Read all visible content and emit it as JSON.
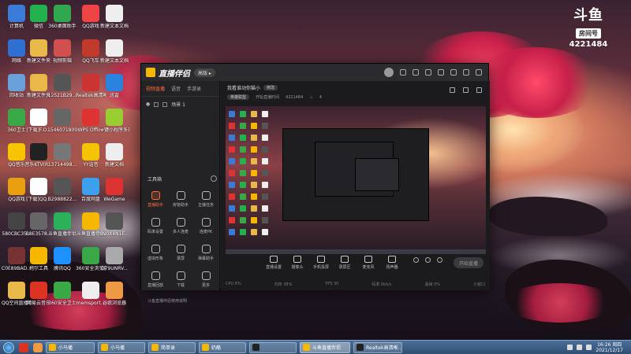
{
  "watermark": {
    "logo": "斗鱼",
    "sub": "房间号",
    "room_number": "4221484"
  },
  "desktop_icons": [
    {
      "label": "计算机",
      "icon": "computer-icon",
      "color": "#3b7bd8"
    },
    {
      "label": "微信",
      "icon": "wechat-icon",
      "color": "#22b14c"
    },
    {
      "label": "360桌面助手",
      "icon": "360-icon",
      "color": "#2fa84f"
    },
    {
      "label": "QQ游戏",
      "icon": "qq-game-icon",
      "color": "#e44"
    },
    {
      "label": "新建文本文档",
      "icon": "text-file-icon",
      "color": "#eee"
    },
    {
      "label": "网络",
      "icon": "network-icon",
      "color": "#2f6fd0"
    },
    {
      "label": "新建文件夹",
      "icon": "folder-icon",
      "color": "#e8b84a"
    },
    {
      "label": "视频剪辑",
      "icon": "video-icon",
      "color": "#d05050"
    },
    {
      "label": "QQ飞车",
      "icon": "qq-speed-icon",
      "color": "#c0392b"
    },
    {
      "label": "新建文本文档",
      "icon": "text-file-icon",
      "color": "#eee"
    },
    {
      "label": "回收站",
      "icon": "recycle-bin-icon",
      "color": "#6aa0d8"
    },
    {
      "label": "新建文件夹",
      "icon": "folder-icon",
      "color": "#e8b84a"
    },
    {
      "label": "12521B29...",
      "icon": "image-icon",
      "color": "#555"
    },
    {
      "label": "Realtek高清晰音频管理器",
      "icon": "realtek-icon",
      "color": "#c33"
    },
    {
      "label": "迅雷",
      "icon": "xunlei-icon",
      "color": "#2b83e0"
    },
    {
      "label": "360卫士",
      "icon": "360-safe-icon",
      "color": "#3aa847"
    },
    {
      "label": "[下载]F.O...",
      "icon": "doc-icon",
      "color": "#fff"
    },
    {
      "label": "1546071800",
      "icon": "image-icon",
      "color": "#666"
    },
    {
      "label": "WPS Office",
      "icon": "wps-icon",
      "color": "#d33"
    },
    {
      "label": "一键小程序多开管理",
      "icon": "tool-icon",
      "color": "#9acd32"
    },
    {
      "label": "QQ音乐",
      "icon": "qq-music-icon",
      "color": "#f6c500"
    },
    {
      "label": "音乐KTV(R...",
      "icon": "panda-icon",
      "color": "#222"
    },
    {
      "label": "13714498...",
      "icon": "image-icon",
      "color": "#777"
    },
    {
      "label": "YY语音",
      "icon": "yy-icon",
      "color": "#f5c400"
    },
    {
      "label": "新建文档",
      "icon": "text-file-icon",
      "color": "#eee"
    },
    {
      "label": "QQ游戏",
      "icon": "qq-game-icon",
      "color": "#e8a010"
    },
    {
      "label": "[下载]QQ...",
      "icon": "doc-icon",
      "color": "#fff"
    },
    {
      "label": "B2988822...",
      "icon": "image-icon",
      "color": "#555"
    },
    {
      "label": "百度网盘",
      "icon": "baidu-pan-icon",
      "color": "#3ca0ef"
    },
    {
      "label": "WeGame",
      "icon": "wegame-icon",
      "color": "#d33"
    },
    {
      "label": "580CBC35...",
      "icon": "image-icon",
      "color": "#444"
    },
    {
      "label": "B8E3578...",
      "icon": "image-icon",
      "color": "#666"
    },
    {
      "label": "斗鱼直播伴侣",
      "icon": "douyu-icon",
      "color": "#2bb15a"
    },
    {
      "label": "斗鱼直播伴侣",
      "icon": "douyu-icon",
      "color": "#f5b700"
    },
    {
      "label": "6N0X4N1E...",
      "icon": "image-icon",
      "color": "#555"
    },
    {
      "label": "C0E89BAD...",
      "icon": "image-icon",
      "color": "#733"
    },
    {
      "label": "柯尔工具",
      "icon": "tool-icon",
      "color": "#f5b700"
    },
    {
      "label": "腾讯QQ",
      "icon": "qq-icon",
      "color": "#1e90ff"
    },
    {
      "label": "360安全浏览器",
      "icon": "360-browser-icon",
      "color": "#3aa847"
    },
    {
      "label": "D79UNRV...",
      "icon": "image-icon",
      "color": "#aaa"
    },
    {
      "label": "QQ空间直播助手",
      "icon": "folder-icon",
      "color": "#e8b84a"
    },
    {
      "label": "网易云音乐",
      "icon": "netease-music-icon",
      "color": "#d32"
    },
    {
      "label": "360安全卫士",
      "icon": "360-safe-icon",
      "color": "#3aa847"
    },
    {
      "label": "memsport...",
      "icon": "folder-icon",
      "color": "#eee"
    },
    {
      "label": "谷歌浏览器",
      "icon": "chrome-icon",
      "color": "#e94"
    }
  ],
  "app": {
    "title": "直播伴侣",
    "badge": "高版 ▸",
    "left_tabs": [
      "视频直播",
      "语音",
      "手游录"
    ],
    "scene_label": "场景 1",
    "tools_title": "工具箱",
    "tools": [
      {
        "label": "直播助手",
        "active": true
      },
      {
        "label": "房管助手",
        "active": false
      },
      {
        "label": "主播任务",
        "active": false
      },
      {
        "label": "码率设置",
        "active": false
      },
      {
        "label": "多人连麦",
        "active": false
      },
      {
        "label": "连麦PK",
        "active": false
      },
      {
        "label": "虚拟形象",
        "active": false
      },
      {
        "label": "录屏",
        "active": false
      },
      {
        "label": "弹幕助手",
        "active": false
      },
      {
        "label": "直播回放",
        "active": false
      },
      {
        "label": "下载",
        "active": false
      },
      {
        "label": "更多",
        "active": false
      }
    ],
    "notice": "斗鱼直播伴侣使用说明",
    "room_title": "我看谁动你猫小",
    "room_title_tag": "修改",
    "room_category": "英雄联盟",
    "room_meta_label": "开始直播时间",
    "room_number": "4221484",
    "heat": "4",
    "controls": [
      "直播设置",
      "摄像头",
      "手机投屏",
      "录屏区",
      "麦克风",
      "扬声器"
    ],
    "start_label": "开始直播",
    "status": [
      "CPU 6%",
      "内存 38%",
      "FPS 30",
      "码率 0kb/s",
      "丢帧 0%",
      "小窗口"
    ]
  },
  "taskbar": {
    "tasks": [
      {
        "label": "小马播",
        "color": "#f5b700"
      },
      {
        "label": "小马播",
        "color": "#f5b700"
      },
      {
        "label": "简单录",
        "color": "#f5b700"
      },
      {
        "label": "奶酪",
        "color": "#f5b700"
      },
      {
        "label": "",
        "color": "#222"
      },
      {
        "label": "斗鱼直播伴侣",
        "color": "#f5b700",
        "active": true
      },
      {
        "label": "Realtek高清晰...",
        "color": "#222"
      }
    ],
    "time": "16:26 周四",
    "date": "2021/12/17"
  }
}
